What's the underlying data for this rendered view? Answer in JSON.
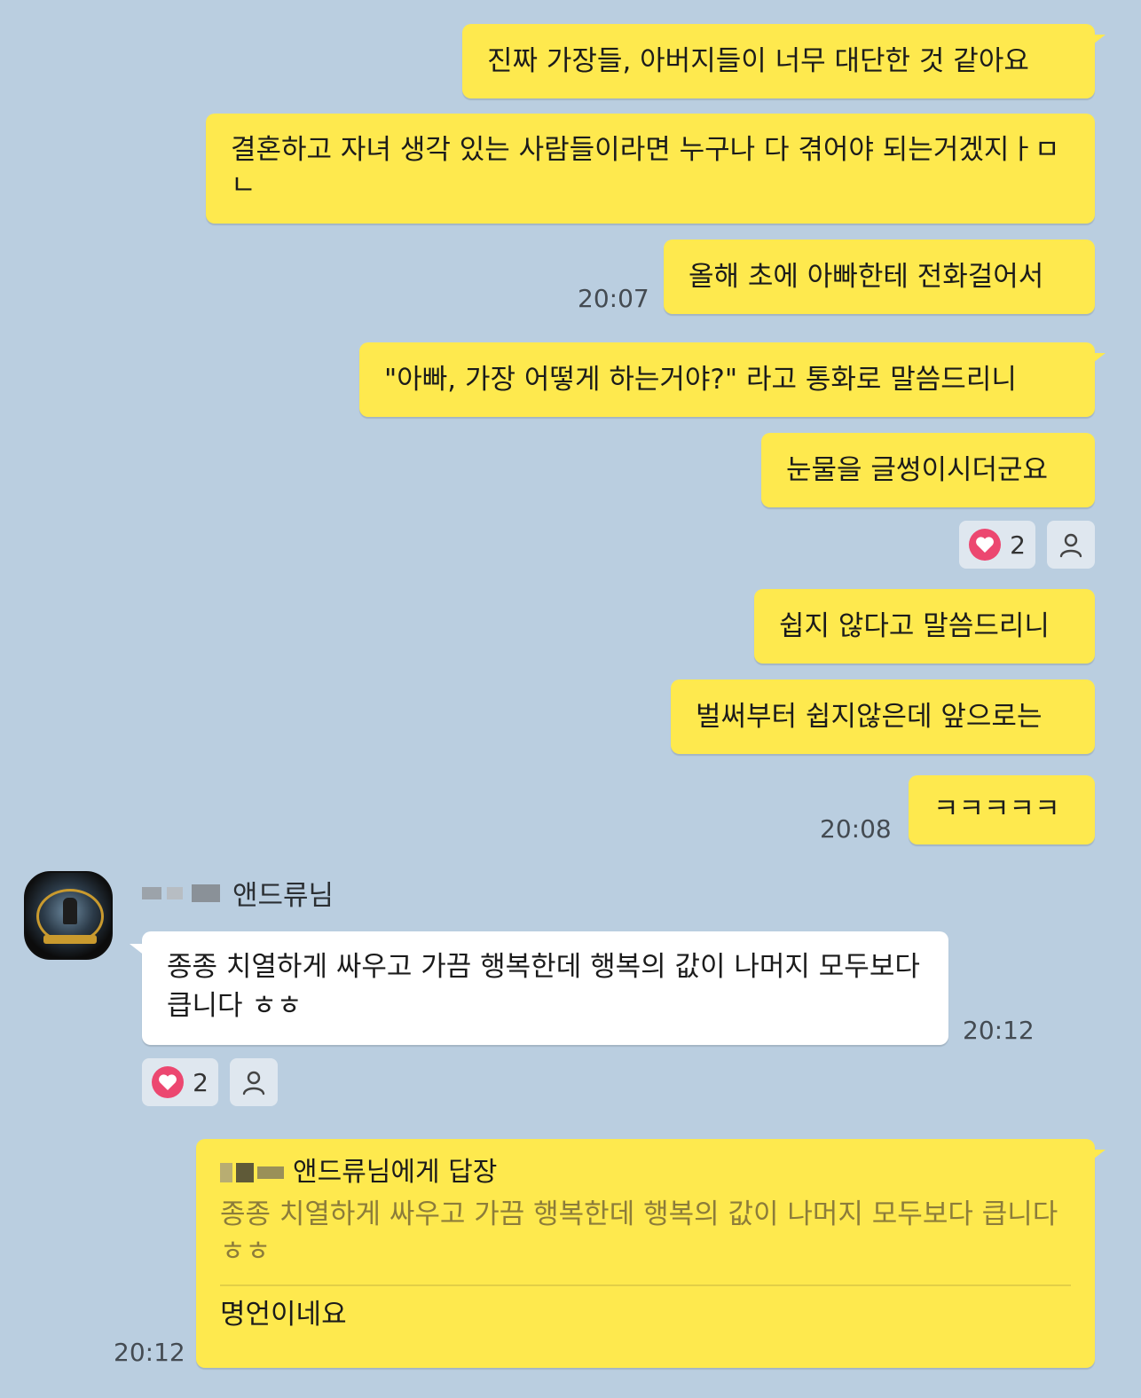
{
  "messages_sent_1": [
    "진짜 가장들, 아버지들이 너무 대단한 것 같아요",
    "결혼하고 자녀 생각 있는 사람들이라면 누구나 다 겪어야 되는거겠지ㅏㅁㄴ",
    "올해 초에 아빠한테 전화걸어서"
  ],
  "time_1": "20:07",
  "messages_sent_2": [
    "\"아빠, 가장 어떻게 하는거야?\" 라고 통화로 말씀드리니",
    "눈물을 글썽이시더군요"
  ],
  "reaction_1": {
    "heart_count": "2",
    "heart_icon": "heart-icon",
    "user_icon": "person-icon"
  },
  "messages_sent_3": [
    "쉽지 않다고 말씀드리니",
    "벌써부터 쉽지않은데 앞으로는",
    "ㅋㅋㅋㅋㅋ"
  ],
  "time_2": "20:08",
  "received": {
    "sender_suffix": "앤드류님",
    "text": "종종 치열하게 싸우고 가끔 행복한데 행복의 값이 나머지 모두보다 큽니다 ㅎㅎ",
    "time": "20:12",
    "heart_count": "2"
  },
  "reply": {
    "header_suffix": "앤드류님에게 답장",
    "quote": "종종 치열하게 싸우고 가끔 행복한데 행복의 값이 나머지 모두보다 큽니다 ㅎㅎ",
    "body": "명언이네요",
    "time": "20:12"
  },
  "colors": {
    "background": "#bacee0",
    "my_bubble": "#fee94e",
    "their_bubble": "#ffffff",
    "heart": "#ec4770"
  }
}
